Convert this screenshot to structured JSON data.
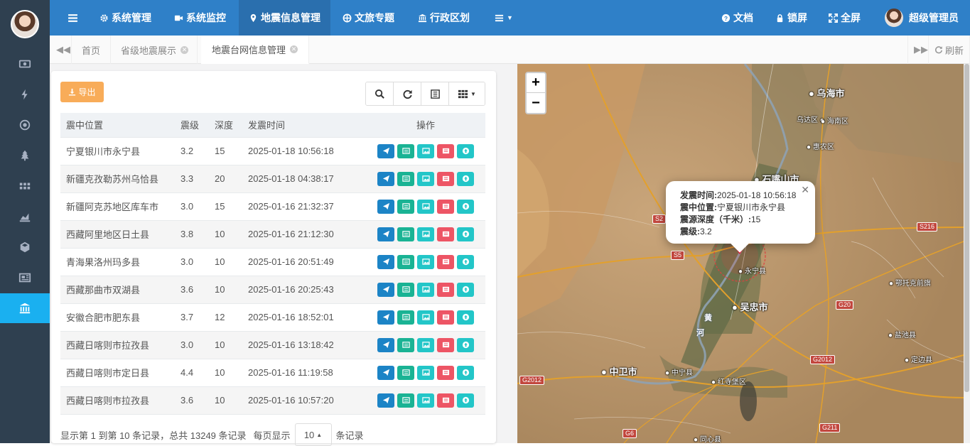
{
  "nav": {
    "items": [
      {
        "label": "系统管理",
        "icon": "gear-icon"
      },
      {
        "label": "系统监控",
        "icon": "video-icon"
      },
      {
        "label": "地震信息管理",
        "icon": "map-pin-icon"
      },
      {
        "label": "文旅专题",
        "icon": "globe-icon"
      },
      {
        "label": "行政区划",
        "icon": "bank-icon"
      }
    ],
    "right": {
      "docs": "文档",
      "lock": "锁屏",
      "fullscreen": "全屏",
      "user": "超级管理员"
    }
  },
  "sidebar": {
    "icons": [
      "money-icon",
      "bolt-icon",
      "target-icon",
      "tree-icon",
      "grid-icon",
      "chart-icon",
      "cube-icon",
      "newspaper-icon",
      "bank-icon"
    ]
  },
  "tabs": {
    "items": [
      {
        "label": "首页",
        "closable": false
      },
      {
        "label": "省级地震展示",
        "closable": true
      },
      {
        "label": "地震台网信息管理",
        "closable": true
      }
    ],
    "refresh": "刷新"
  },
  "panel": {
    "export_label": "导出",
    "columns": [
      "震中位置",
      "震级",
      "深度",
      "发震时间",
      "操作"
    ],
    "rows": [
      {
        "location": "宁夏银川市永宁县",
        "magnitude": "3.2",
        "depth": "15",
        "time": "2025-01-18 10:56:18"
      },
      {
        "location": "新疆克孜勒苏州乌恰县",
        "magnitude": "3.3",
        "depth": "20",
        "time": "2025-01-18 04:38:17"
      },
      {
        "location": "新疆阿克苏地区库车市",
        "magnitude": "3.0",
        "depth": "15",
        "time": "2025-01-16 21:32:37"
      },
      {
        "location": "西藏阿里地区日土县",
        "magnitude": "3.8",
        "depth": "10",
        "time": "2025-01-16 21:12:30"
      },
      {
        "location": "青海果洛州玛多县",
        "magnitude": "3.0",
        "depth": "10",
        "time": "2025-01-16 20:51:49"
      },
      {
        "location": "西藏那曲市双湖县",
        "magnitude": "3.6",
        "depth": "10",
        "time": "2025-01-16 20:25:43"
      },
      {
        "location": "安徽合肥市肥东县",
        "magnitude": "3.7",
        "depth": "12",
        "time": "2025-01-16 18:52:01"
      },
      {
        "location": "西藏日喀则市拉孜县",
        "magnitude": "3.0",
        "depth": "10",
        "time": "2025-01-16 13:18:42"
      },
      {
        "location": "西藏日喀则市定日县",
        "magnitude": "4.4",
        "depth": "10",
        "time": "2025-01-16 11:19:58"
      },
      {
        "location": "西藏日喀则市拉孜县",
        "magnitude": "3.6",
        "depth": "10",
        "time": "2025-01-16 10:57:20"
      }
    ],
    "op_colors": [
      "#1c84c6",
      "#1ab394",
      "#23c6c8",
      "#ed5565",
      "#23c6c8"
    ],
    "pager": {
      "summary": "显示第 1 到第 10 条记录，总共 13249 条记录",
      "per_page_prefix": "每页显示",
      "per_page_value": "10",
      "per_page_suffix": "条记录"
    }
  },
  "map": {
    "zoom_in": "+",
    "zoom_out": "−",
    "popup": {
      "time_label": "发震时间:",
      "time_value": "2025-01-18 10:56:18",
      "location_label": "震中位置:",
      "location_value": "宁夏银川市永宁县",
      "depth_label": "震源深度（千米）:",
      "depth_value": "15",
      "magnitude_label": "震级:",
      "magnitude_value": "3.2"
    },
    "cities": [
      "乌海市",
      "石嘴山市",
      "吴忠市",
      "中卫市"
    ],
    "towns": [
      "乌达区",
      "海南区",
      "惠农区",
      "永宁县",
      "鄂托克前旗",
      "盐池县",
      "定边县",
      "中宁县",
      "红寺堡区",
      "同心县"
    ],
    "roads": [
      "S216",
      "S2",
      "S5",
      "G20",
      "G2012",
      "G2012",
      "G6",
      "G211"
    ],
    "river": [
      "黄",
      "河"
    ]
  }
}
